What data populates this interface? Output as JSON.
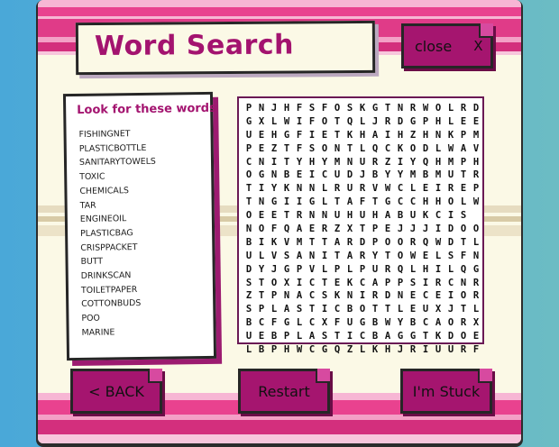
{
  "header": {
    "title": "Word Search",
    "close_label": "close",
    "close_glyph": "X"
  },
  "word_list": {
    "title": "Look for these words",
    "words": [
      "FISHINGNET",
      "PLASTICBOTTLE",
      "SANITARYTOWELS",
      "TOXIC",
      "CHEMICALS",
      "TAR",
      "ENGINEOIL",
      "PLASTICBAG",
      "CRISPPACKET",
      "BUTT",
      "DRINKSCAN",
      "TOILETPAPER",
      "COTTONBUDS",
      "POO",
      "MARINE"
    ]
  },
  "grid": {
    "rows": [
      "PNJHFSFOSKGTNRWOLRD",
      "GXLWIFOTQLJRDGPHLEE",
      "UEHGFIETKHAIHZHNKPM",
      "PEZTFSONTLQCKODLWAV",
      "CNITYHYMNURZIYQHMPH",
      "OGNBEICUDJBYYMBMUTR",
      "TIYKNNLRURVWCLEIREP",
      "TNGIIGLTAFTGCCHHOLW",
      "OEETRNNUHUHABUKCIS",
      "NOFQAERZXTPEJJJIDOO",
      "BIKVMTTARDPOORQWDTL",
      "ULVSANITARYTOWELSFN",
      "DYJGPVLPLPURQLHILQG",
      "STOXICTEKCAPPSIRCNR",
      "ZTPNACSKNIRDNECEIOR",
      "SPLASTICBOTTLEUXJTL",
      "BCFGLCXFUGBWYBCAORX",
      "UEBPLASTICBAGGTKDOE",
      "LBPHWCGQZLKHJRIUURF"
    ]
  },
  "buttons": {
    "back": "< BACK",
    "restart": "Restart",
    "stuck": "I'm Stuck"
  },
  "colors": {
    "accent": "#a5156f",
    "pink": "#e9428f",
    "cream": "#fbf9e6",
    "outline": "#262626"
  }
}
